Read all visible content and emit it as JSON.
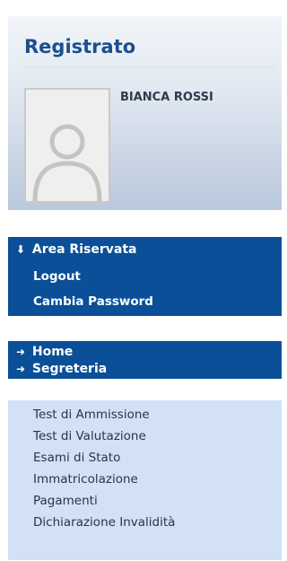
{
  "registered": {
    "title": "Registrato",
    "user_name": "BIANCA ROSSI"
  },
  "area_riservata": {
    "header": "Area Riservata",
    "links": [
      "Logout",
      "Cambia Password"
    ]
  },
  "nav": {
    "home": "Home",
    "segreteria": "Segreteria"
  },
  "segreteria_items": [
    "Test di Ammissione",
    "Test di Valutazione",
    "Esami di Stato",
    "Immatricolazione",
    "Pagamenti",
    "Dichiarazione Invalidità"
  ],
  "icons": {
    "expanded_arrow": "down-arrow-icon",
    "nav_arrow": "right-arrow-icon",
    "avatar": "user-placeholder-icon"
  },
  "colors": {
    "title_blue": "#1a4f8e",
    "menu_dark_blue": "#0a4f97",
    "menu_light_blue": "#d2e1f6"
  }
}
